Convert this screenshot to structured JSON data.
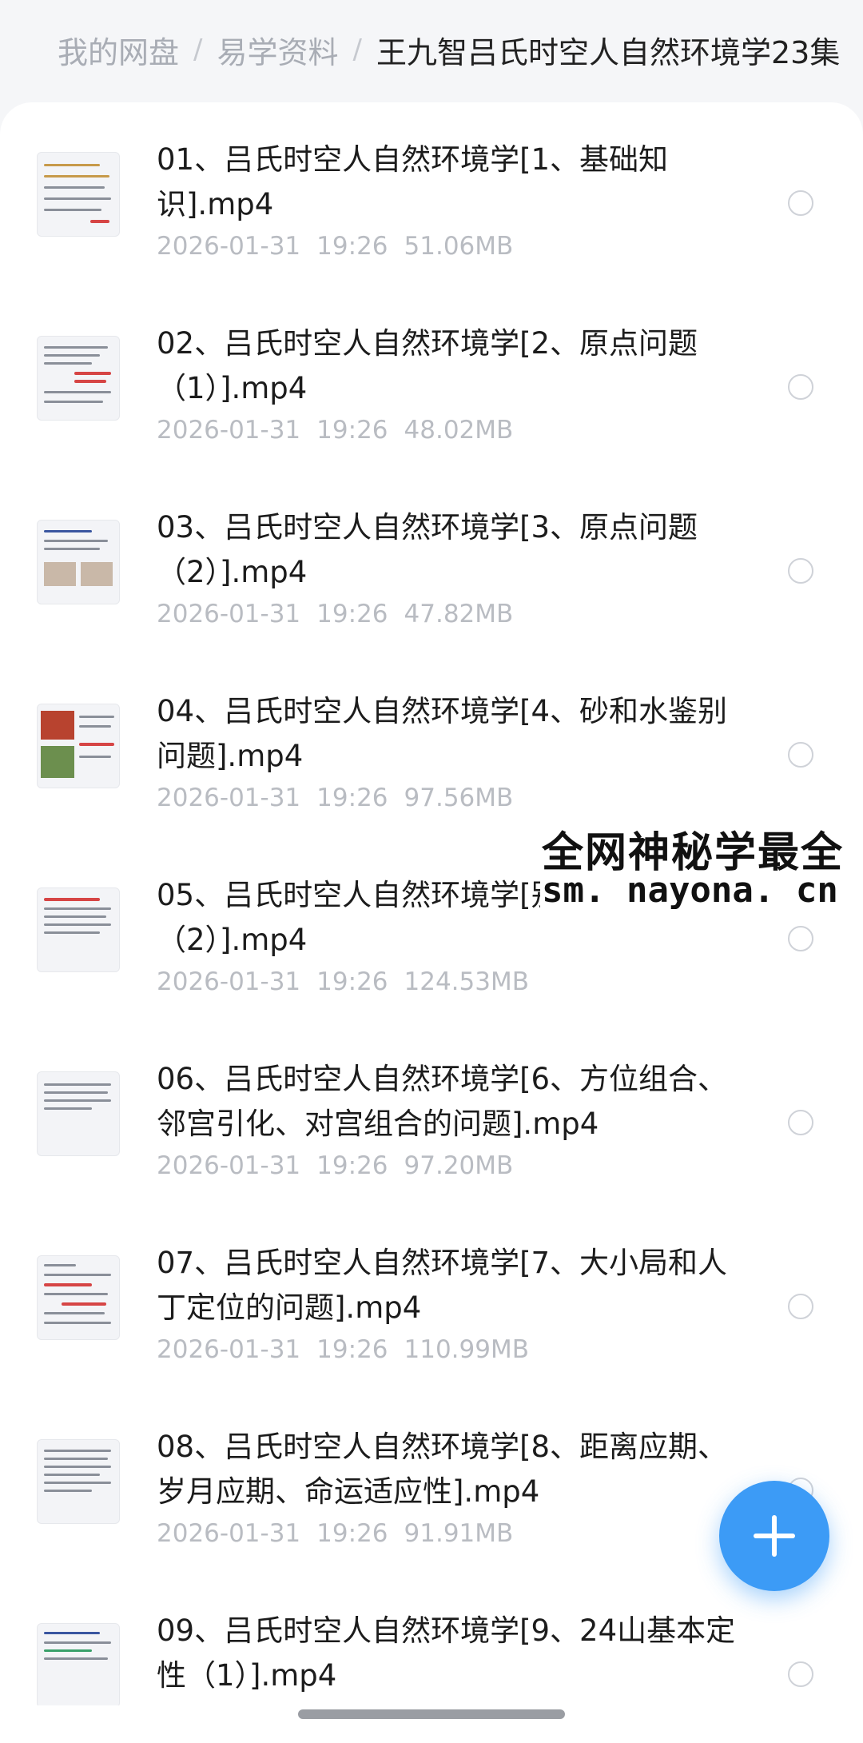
{
  "breadcrumb": {
    "items": [
      "我的网盘",
      "易学资料",
      "王九智吕氏时空人自然环境学23集"
    ],
    "separator": "/"
  },
  "files": [
    {
      "name": "01、吕氏时空人自然环境学[1、基础知识].mp4",
      "date": "2026-01-31",
      "time": "19:26",
      "size": "51.06MB"
    },
    {
      "name": "02、吕氏时空人自然环境学[2、原点问题（1）].mp4",
      "date": "2026-01-31",
      "time": "19:26",
      "size": "48.02MB"
    },
    {
      "name": "03、吕氏时空人自然环境学[3、原点问题（2）].mp4",
      "date": "2026-01-31",
      "time": "19:26",
      "size": "47.82MB"
    },
    {
      "name": "04、吕氏时空人自然环境学[4、砂和水鉴别问题].mp4",
      "date": "2026-01-31",
      "time": "19:26",
      "size": "97.56MB"
    },
    {
      "name": "05、吕氏时空人自然环境学[别问题 （2）].mp4",
      "date": "2026-01-31",
      "time": "19:26",
      "size": "124.53MB"
    },
    {
      "name": "06、吕氏时空人自然环境学[6、方位组合、邻宫引化、对宫组合的问题].mp4",
      "date": "2026-01-31",
      "time": "19:26",
      "size": "97.20MB"
    },
    {
      "name": "07、吕氏时空人自然环境学[7、大小局和人丁定位的问题].mp4",
      "date": "2026-01-31",
      "time": "19:26",
      "size": "110.99MB"
    },
    {
      "name": "08、吕氏时空人自然环境学[8、距离应期、岁月应期、命运适应性].mp4",
      "date": "2026-01-31",
      "time": "19:26",
      "size": "91.91MB"
    },
    {
      "name": "09、吕氏时空人自然环境学[9、24山基本定性（1）].mp4",
      "date": "",
      "time": "",
      "size": ""
    }
  ],
  "watermark": {
    "line1": "全网神秘学最全",
    "line2": "sm. nayona. cn"
  },
  "fab": {
    "icon": "plus-icon",
    "color": "#3c9bf6"
  },
  "colors": {
    "accent": "#3c9bf6",
    "meta_text": "#b9bcc2",
    "breadcrumb_inactive": "#a9adb5"
  }
}
